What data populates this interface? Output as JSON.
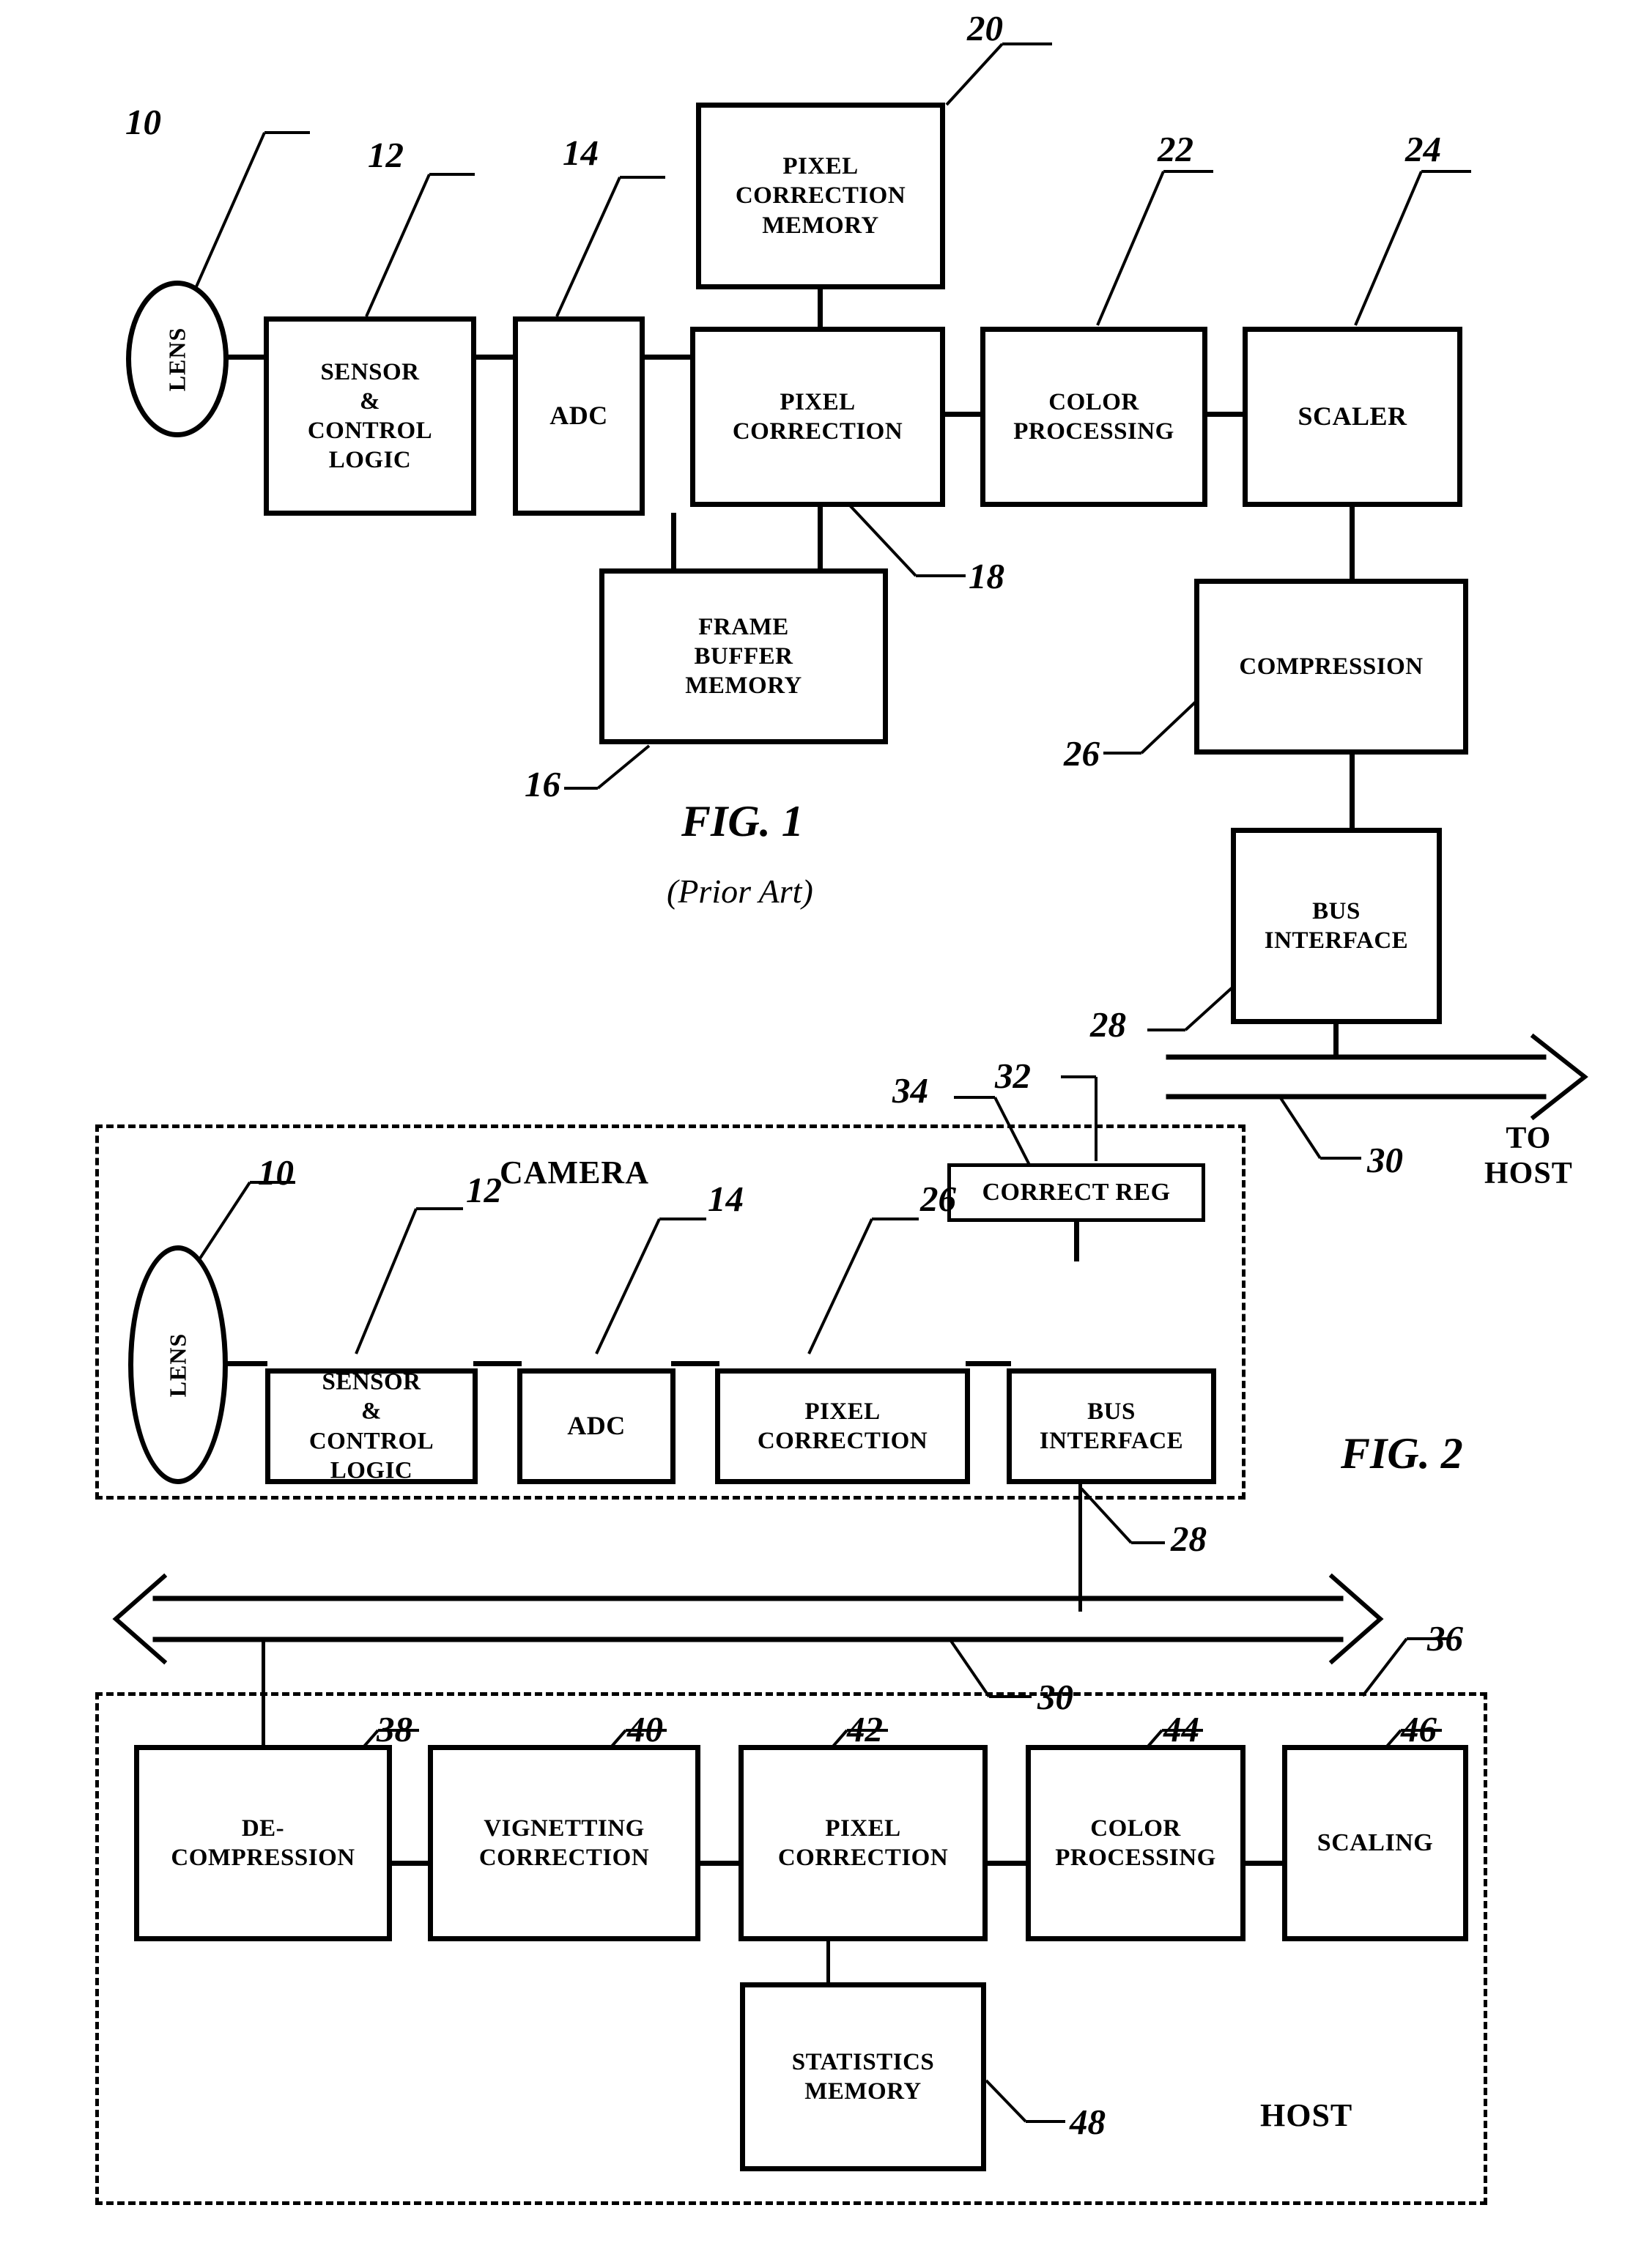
{
  "figures": [
    {
      "caption": "FIG. 1",
      "subcaption": "(Prior Art)"
    },
    {
      "caption": "FIG. 2"
    }
  ],
  "fig1": {
    "caption": "FIG. 1",
    "subcaption": "(Prior Art)",
    "blocks": {
      "lens": "LENS",
      "sensor": "SENSOR\n&\nCONTROL\nLOGIC",
      "sensor_l1": "SENSOR",
      "sensor_l2": "&",
      "sensor_l3": "CONTROL",
      "sensor_l4": "LOGIC",
      "adc": "ADC",
      "pixel_correction_memory_l1": "PIXEL",
      "pixel_correction_memory_l2": "CORRECTION",
      "pixel_correction_memory_l3": "MEMORY",
      "pixel_correction_l1": "PIXEL",
      "pixel_correction_l2": "CORRECTION",
      "color_processing_l1": "COLOR",
      "color_processing_l2": "PROCESSING",
      "scaler": "SCALER",
      "frame_buffer_l1": "FRAME",
      "frame_buffer_l2": "BUFFER",
      "frame_buffer_l3": "MEMORY",
      "compression": "COMPRESSION",
      "bus_interface_l1": "BUS",
      "bus_interface_l2": "INTERFACE"
    },
    "to_host_l1": "TO",
    "to_host_l2": "HOST",
    "numerals": {
      "lens": "10",
      "sensor": "12",
      "adc": "14",
      "frame_buffer": "16",
      "pixel_correction": "18",
      "pixel_correction_memory": "20",
      "color_processing": "22",
      "scaler": "24",
      "compression": "26",
      "bus_interface": "28",
      "bus": "30"
    }
  },
  "fig2": {
    "caption": "FIG. 2",
    "camera_label": "CAMERA",
    "host_label": "HOST",
    "blocks": {
      "lens": "LENS",
      "sensor_l1": "SENSOR",
      "sensor_l2": "&",
      "sensor_l3": "CONTROL",
      "sensor_l4": "LOGIC",
      "adc": "ADC",
      "pixel_correction_l1": "PIXEL",
      "pixel_correction_l2": "CORRECTION",
      "bus_interface_l1": "BUS",
      "bus_interface_l2": "INTERFACE",
      "correct_reg": "CORRECT REG",
      "decompression_l1": "DE-",
      "decompression_l2": "COMPRESSION",
      "vignetting_l1": "VIGNETTING",
      "vignetting_l2": "CORRECTION",
      "host_pixel_correction_l1": "PIXEL",
      "host_pixel_correction_l2": "CORRECTION",
      "host_color_processing_l1": "COLOR",
      "host_color_processing_l2": "PROCESSING",
      "scaling": "SCALING",
      "statistics_memory_l1": "STATISTICS",
      "statistics_memory_l2": "MEMORY"
    },
    "numerals": {
      "lens": "10",
      "sensor": "12",
      "adc": "14",
      "pixel_correction": "26",
      "bus_interface": "28",
      "correct_reg_left": "34",
      "correct_reg_right": "32",
      "bus": "30",
      "host_group": "36",
      "decompression": "38",
      "vignetting": "40",
      "host_pixel_correction": "42",
      "host_color_processing": "44",
      "scaling": "46",
      "statistics_memory": "48"
    }
  },
  "colors": {
    "ink": "#000000",
    "paper": "#ffffff"
  }
}
